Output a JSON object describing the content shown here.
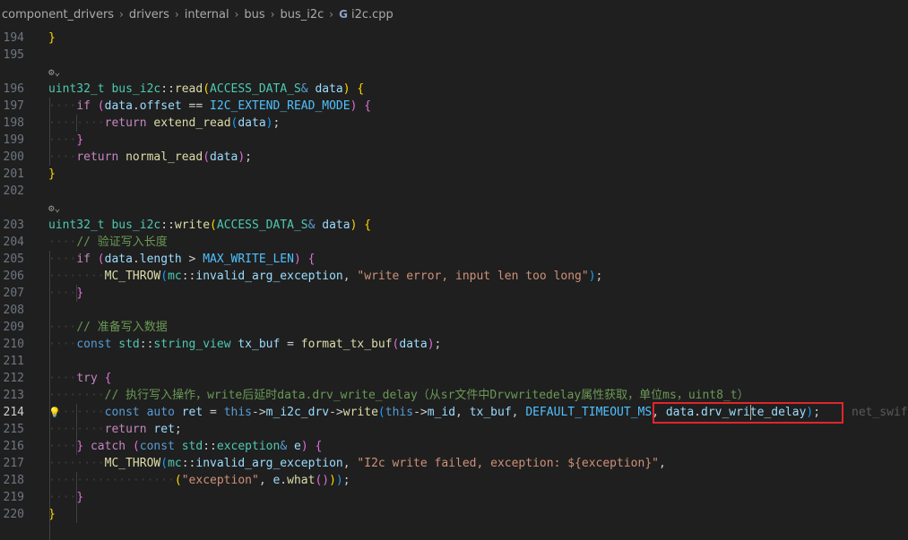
{
  "breadcrumb": {
    "items": [
      "component_drivers",
      "drivers",
      "internal",
      "bus",
      "bus_i2c"
    ],
    "file": "i2c.cpp",
    "file_icon": "C++"
  },
  "editor": {
    "active_line": "214",
    "ghost_text": "net_swif",
    "codelens_icon": "⚙⌄",
    "lightbulb_icon": "💡",
    "lines": [
      {
        "n": "194",
        "tokens": [
          [
            "b1",
            "}"
          ]
        ]
      },
      {
        "n": "195",
        "tokens": []
      },
      {
        "codelens": true
      },
      {
        "n": "196",
        "tokens": [
          [
            "ty",
            "uint32_t"
          ],
          [
            "pl",
            " "
          ],
          [
            "ty",
            "bus_i2c"
          ],
          [
            "pl",
            "::"
          ],
          [
            "fn",
            "read"
          ],
          [
            "b1",
            "("
          ],
          [
            "ty",
            "ACCESS_DATA_S"
          ],
          [
            "kw",
            "&"
          ],
          [
            "pl",
            " "
          ],
          [
            "var",
            "data"
          ],
          [
            "b1",
            ")"
          ],
          [
            "pl",
            " "
          ],
          [
            "b1",
            "{"
          ]
        ]
      },
      {
        "n": "197",
        "tokens": [
          [
            "ws",
            "····"
          ],
          [
            "ctl",
            "if"
          ],
          [
            "pl",
            " "
          ],
          [
            "b2",
            "("
          ],
          [
            "var",
            "data"
          ],
          [
            "pl",
            "."
          ],
          [
            "var",
            "offset"
          ],
          [
            "pl",
            " == "
          ],
          [
            "mac",
            "I2C_EXTEND_READ_MODE"
          ],
          [
            "b2",
            ")"
          ],
          [
            "pl",
            " "
          ],
          [
            "b2",
            "{"
          ]
        ]
      },
      {
        "n": "198",
        "tokens": [
          [
            "ws",
            "········"
          ],
          [
            "ctl",
            "return"
          ],
          [
            "pl",
            " "
          ],
          [
            "fn",
            "extend_read"
          ],
          [
            "b3",
            "("
          ],
          [
            "var",
            "data"
          ],
          [
            "b3",
            ")"
          ],
          [
            "pl",
            ";"
          ]
        ]
      },
      {
        "n": "199",
        "tokens": [
          [
            "ws",
            "····"
          ],
          [
            "b2",
            "}"
          ]
        ]
      },
      {
        "n": "200",
        "tokens": [
          [
            "ws",
            "····"
          ],
          [
            "ctl",
            "return"
          ],
          [
            "pl",
            " "
          ],
          [
            "fn",
            "normal_read"
          ],
          [
            "b2",
            "("
          ],
          [
            "var",
            "data"
          ],
          [
            "b2",
            ")"
          ],
          [
            "pl",
            ";"
          ]
        ]
      },
      {
        "n": "201",
        "tokens": [
          [
            "b1",
            "}"
          ]
        ]
      },
      {
        "n": "202",
        "tokens": []
      },
      {
        "codelens": true
      },
      {
        "n": "203",
        "tokens": [
          [
            "ty",
            "uint32_t"
          ],
          [
            "pl",
            " "
          ],
          [
            "ty",
            "bus_i2c"
          ],
          [
            "pl",
            "::"
          ],
          [
            "fn",
            "write"
          ],
          [
            "b1",
            "("
          ],
          [
            "ty",
            "ACCESS_DATA_S"
          ],
          [
            "kw",
            "&"
          ],
          [
            "pl",
            " "
          ],
          [
            "var",
            "data"
          ],
          [
            "b1",
            ")"
          ],
          [
            "pl",
            " "
          ],
          [
            "b1",
            "{"
          ]
        ]
      },
      {
        "n": "204",
        "tokens": [
          [
            "ws",
            "····"
          ],
          [
            "cmt",
            "// 验证写入长度"
          ]
        ]
      },
      {
        "n": "205",
        "tokens": [
          [
            "ws",
            "····"
          ],
          [
            "ctl",
            "if"
          ],
          [
            "pl",
            " "
          ],
          [
            "b2",
            "("
          ],
          [
            "var",
            "data"
          ],
          [
            "pl",
            "."
          ],
          [
            "var",
            "length"
          ],
          [
            "pl",
            " > "
          ],
          [
            "mac",
            "MAX_WRITE_LEN"
          ],
          [
            "b2",
            ")"
          ],
          [
            "pl",
            " "
          ],
          [
            "b2",
            "{"
          ]
        ]
      },
      {
        "n": "206",
        "tokens": [
          [
            "ws",
            "········"
          ],
          [
            "fn",
            "MC_THROW"
          ],
          [
            "b3",
            "("
          ],
          [
            "ty",
            "mc"
          ],
          [
            "pl",
            "::"
          ],
          [
            "var",
            "invalid_arg_exception"
          ],
          [
            "pl",
            ", "
          ],
          [
            "str",
            "\"write error, input len too long\""
          ],
          [
            "b3",
            ")"
          ],
          [
            "pl",
            ";"
          ]
        ]
      },
      {
        "n": "207",
        "tokens": [
          [
            "ws",
            "····"
          ],
          [
            "b2",
            "}"
          ]
        ]
      },
      {
        "n": "208",
        "tokens": []
      },
      {
        "n": "209",
        "tokens": [
          [
            "ws",
            "····"
          ],
          [
            "cmt",
            "// 准备写入数据"
          ]
        ]
      },
      {
        "n": "210",
        "tokens": [
          [
            "ws",
            "····"
          ],
          [
            "kw",
            "const"
          ],
          [
            "pl",
            " "
          ],
          [
            "ty",
            "std"
          ],
          [
            "pl",
            "::"
          ],
          [
            "ty",
            "string_view"
          ],
          [
            "pl",
            " "
          ],
          [
            "var",
            "tx_buf"
          ],
          [
            "pl",
            " = "
          ],
          [
            "fn",
            "format_tx_buf"
          ],
          [
            "b2",
            "("
          ],
          [
            "var",
            "data"
          ],
          [
            "b2",
            ")"
          ],
          [
            "pl",
            ";"
          ]
        ]
      },
      {
        "n": "211",
        "tokens": []
      },
      {
        "n": "212",
        "tokens": [
          [
            "ws",
            "····"
          ],
          [
            "ctl",
            "try"
          ],
          [
            "pl",
            " "
          ],
          [
            "b2",
            "{"
          ]
        ]
      },
      {
        "n": "213",
        "tokens": [
          [
            "ws",
            "········"
          ],
          [
            "cmt",
            "// 执行写入操作，write后延时data.drv_write_delay（从sr文件中Drvwritedelay属性获取，单位ms，uint8_t）"
          ]
        ]
      },
      {
        "n": "214",
        "tokens": [
          [
            "ws",
            "········"
          ],
          [
            "kw",
            "const"
          ],
          [
            "pl",
            " "
          ],
          [
            "kw",
            "auto"
          ],
          [
            "pl",
            " "
          ],
          [
            "var",
            "ret"
          ],
          [
            "pl",
            " = "
          ],
          [
            "kw",
            "this"
          ],
          [
            "pl",
            "->"
          ],
          [
            "var",
            "m_i2c_drv"
          ],
          [
            "pl",
            "->"
          ],
          [
            "fn",
            "write"
          ],
          [
            "b3",
            "("
          ],
          [
            "kw",
            "this"
          ],
          [
            "pl",
            "->"
          ],
          [
            "var",
            "m_id"
          ],
          [
            "pl",
            ", "
          ],
          [
            "var",
            "tx_buf"
          ],
          [
            "pl",
            ", "
          ],
          [
            "mac",
            "DEFAULT_TIMEOUT_MS"
          ],
          [
            "pl",
            ", "
          ],
          [
            "var",
            "data"
          ],
          [
            "pl",
            "."
          ],
          [
            "var",
            "drv_write_delay"
          ],
          [
            "b3",
            ")"
          ],
          [
            "pl",
            ";"
          ]
        ]
      },
      {
        "n": "215",
        "tokens": [
          [
            "ws",
            "········"
          ],
          [
            "ctl",
            "return"
          ],
          [
            "pl",
            " "
          ],
          [
            "var",
            "ret"
          ],
          [
            "pl",
            ";"
          ]
        ]
      },
      {
        "n": "216",
        "tokens": [
          [
            "ws",
            "····"
          ],
          [
            "b2",
            "}"
          ],
          [
            "pl",
            " "
          ],
          [
            "ctl",
            "catch"
          ],
          [
            "pl",
            " "
          ],
          [
            "b2",
            "("
          ],
          [
            "kw",
            "const"
          ],
          [
            "pl",
            " "
          ],
          [
            "ty",
            "std"
          ],
          [
            "pl",
            "::"
          ],
          [
            "ty",
            "exception"
          ],
          [
            "kw",
            "&"
          ],
          [
            "pl",
            " "
          ],
          [
            "var",
            "e"
          ],
          [
            "b2",
            ")"
          ],
          [
            "pl",
            " "
          ],
          [
            "b2",
            "{"
          ]
        ]
      },
      {
        "n": "217",
        "tokens": [
          [
            "ws",
            "········"
          ],
          [
            "fn",
            "MC_THROW"
          ],
          [
            "b3",
            "("
          ],
          [
            "ty",
            "mc"
          ],
          [
            "pl",
            "::"
          ],
          [
            "var",
            "invalid_arg_exception"
          ],
          [
            "pl",
            ", "
          ],
          [
            "str",
            "\"I2c write failed, exception: ${exception}\""
          ],
          [
            "pl",
            ","
          ]
        ]
      },
      {
        "n": "218",
        "tokens": [
          [
            "ws",
            "··················"
          ],
          [
            "b1",
            "("
          ],
          [
            "str",
            "\"exception\""
          ],
          [
            "pl",
            ", "
          ],
          [
            "var",
            "e"
          ],
          [
            "pl",
            "."
          ],
          [
            "fn",
            "what"
          ],
          [
            "b2",
            "()"
          ],
          [
            "b1",
            ")"
          ],
          [
            "b3",
            ")"
          ],
          [
            "pl",
            ";"
          ]
        ]
      },
      {
        "n": "219",
        "tokens": [
          [
            "ws",
            "····"
          ],
          [
            "b2",
            "}"
          ]
        ]
      },
      {
        "n": "220",
        "tokens": [
          [
            "b1",
            "}"
          ]
        ]
      }
    ]
  }
}
